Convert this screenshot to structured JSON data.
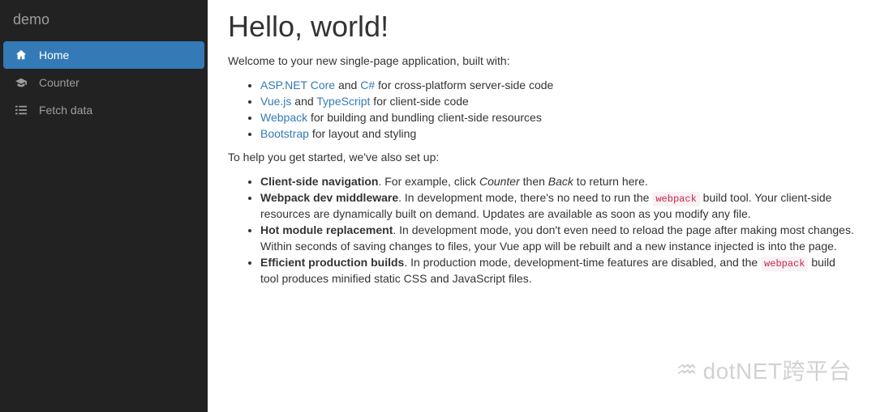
{
  "sidebar": {
    "brand": "demo",
    "items": [
      {
        "label": "Home",
        "icon": "home-icon",
        "active": true
      },
      {
        "label": "Counter",
        "icon": "graduation-cap-icon",
        "active": false
      },
      {
        "label": "Fetch data",
        "icon": "list-icon",
        "active": false
      }
    ]
  },
  "content": {
    "heading": "Hello, world!",
    "intro": "Welcome to your new single-page application, built with:",
    "tech": [
      {
        "link1": "ASP.NET Core",
        "mid": " and ",
        "link2": "C#",
        "tail": " for cross-platform server-side code"
      },
      {
        "link1": "Vue.js",
        "mid": " and ",
        "link2": "TypeScript",
        "tail": " for client-side code"
      },
      {
        "link1": "Webpack",
        "tail": " for building and bundling client-side resources"
      },
      {
        "link1": "Bootstrap",
        "tail": " for layout and styling"
      }
    ],
    "setup_intro": "To help you get started, we've also set up:",
    "features": {
      "f0": {
        "bold": "Client-side navigation",
        "t1": ". For example, click ",
        "em1": "Counter",
        "t2": " then ",
        "em2": "Back",
        "t3": " to return here."
      },
      "f1": {
        "bold": "Webpack dev middleware",
        "t1": ". In development mode, there's no need to run the ",
        "code": "webpack",
        "t2": " build tool. Your client-side resources are dynamically built on demand. Updates are available as soon as you modify any file."
      },
      "f2": {
        "bold": "Hot module replacement",
        "t1": ". In development mode, you don't even need to reload the page after making most changes. Within seconds of saving changes to files, your Vue app will be rebuilt and a new instance injected is into the page."
      },
      "f3": {
        "bold": "Efficient production builds",
        "t1": ". In production mode, development-time features are disabled, and the ",
        "code": "webpack",
        "t2": " build tool produces minified static CSS and JavaScript files."
      }
    }
  },
  "watermark": "dotNET跨平台"
}
